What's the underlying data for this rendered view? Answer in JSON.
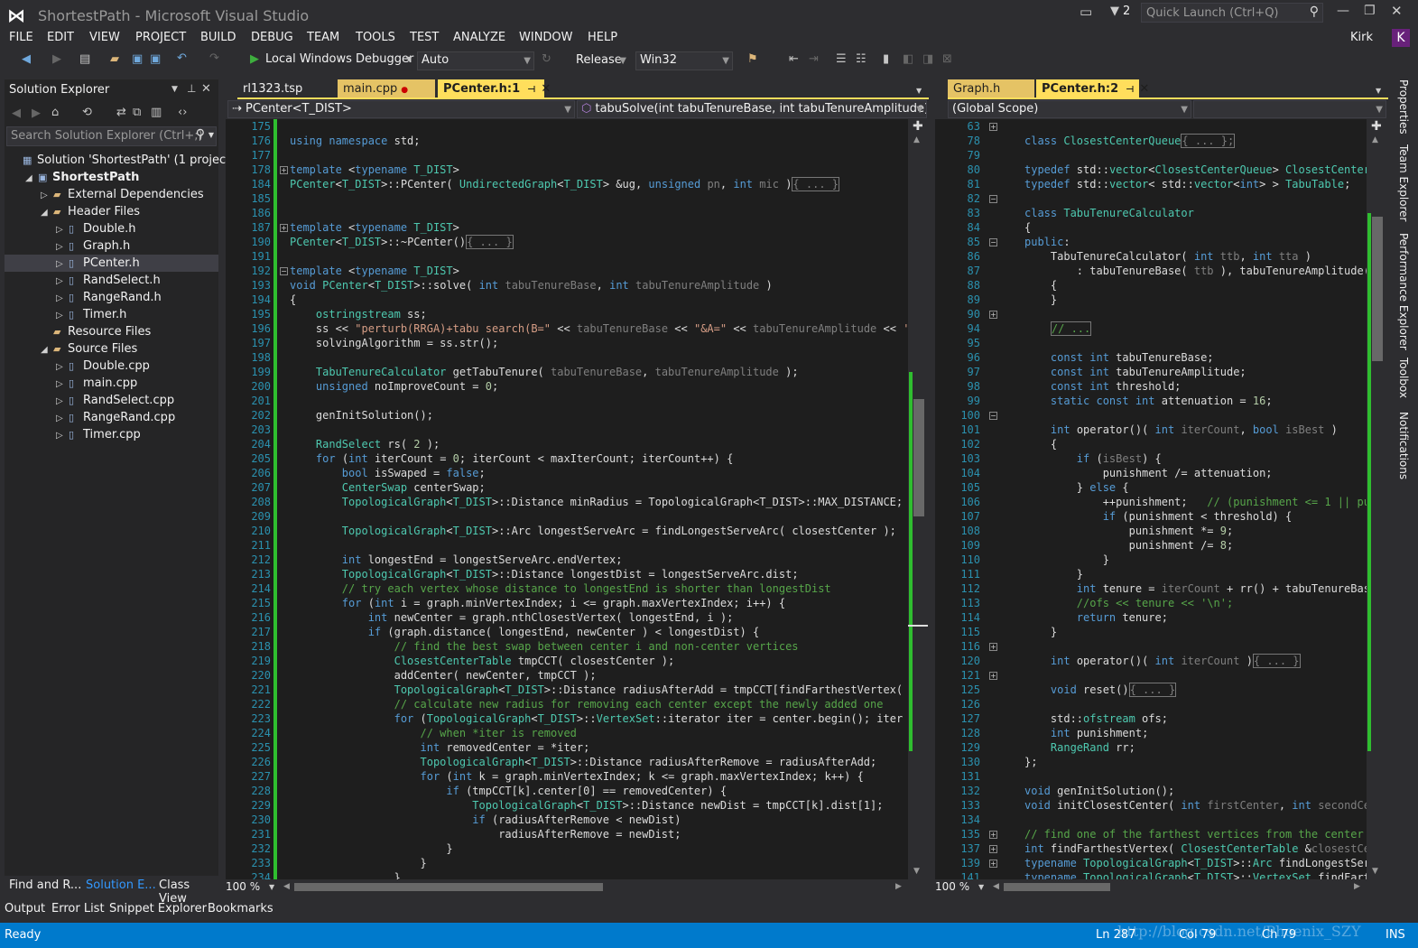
{
  "window": {
    "title": "ShortestPath - Microsoft Visual Studio",
    "notif_count": "2",
    "quick_launch": "Quick Launch (Ctrl+Q)",
    "user": "Kirk",
    "avatar": "K"
  },
  "menu": [
    "FILE",
    "EDIT",
    "VIEW",
    "PROJECT",
    "BUILD",
    "DEBUG",
    "TEAM",
    "TOOLS",
    "TEST",
    "ANALYZE",
    "WINDOW",
    "HELP"
  ],
  "toolbar": {
    "debugger": "Local Windows Debugger",
    "auto": "Auto",
    "config": "Release",
    "platform": "Win32"
  },
  "solution": {
    "title": "Solution Explorer",
    "search": "Search Solution Explorer (Ctrl+;)",
    "items": [
      {
        "label": "Solution 'ShortestPath' (1 project)",
        "indent": 0
      },
      {
        "label": "ShortestPath",
        "indent": 1,
        "bold": true
      },
      {
        "label": "External Dependencies",
        "indent": 2
      },
      {
        "label": "Header Files",
        "indent": 2
      },
      {
        "label": "Double.h",
        "indent": 3
      },
      {
        "label": "Graph.h",
        "indent": 3
      },
      {
        "label": "PCenter.h",
        "indent": 3,
        "selected": true
      },
      {
        "label": "RandSelect.h",
        "indent": 3
      },
      {
        "label": "RangeRand.h",
        "indent": 3
      },
      {
        "label": "Timer.h",
        "indent": 3
      },
      {
        "label": "Resource Files",
        "indent": 2
      },
      {
        "label": "Source Files",
        "indent": 2
      },
      {
        "label": "Double.cpp",
        "indent": 3
      },
      {
        "label": "main.cpp",
        "indent": 3
      },
      {
        "label": "RandSelect.cpp",
        "indent": 3
      },
      {
        "label": "RangeRand.cpp",
        "indent": 3
      },
      {
        "label": "Timer.cpp",
        "indent": 3
      }
    ]
  },
  "bottom_tabs": [
    "Find and R...",
    "Solution E...",
    "Class View"
  ],
  "output_tabs": [
    "Output",
    "Error List",
    "Snippet Explorer",
    "Bookmarks"
  ],
  "status": {
    "ready": "Ready",
    "ln": "Ln 287",
    "col": "Col 79",
    "ch": "Ch 79",
    "ins": "INS",
    "watermark": "http://blog.csdn.net/Phoenix_SZY"
  },
  "left_editor": {
    "tabs": [
      "rl1323.tsp",
      "main.cpp",
      "PCenter.h:1"
    ],
    "nav_left": "PCenter<T_DIST>",
    "nav_right": "tabuSolve(int tabuTenureBase, int tabuTenureAmplitude)",
    "zoom": "100 %"
  },
  "right_editor": {
    "tabs": [
      "Graph.h",
      "PCenter.h:2"
    ],
    "nav_left": "(Global Scope)",
    "zoom": "100 %"
  },
  "side_tabs": [
    "Properties",
    "Team Explorer",
    "Performance Explorer",
    "Toolbox",
    "Notifications"
  ],
  "left_lines": [
    "175",
    "176",
    "177",
    "178",
    "184",
    "185",
    "186",
    "187",
    "190",
    "191",
    "192",
    "193",
    "194",
    "195",
    "196",
    "197",
    "198",
    "199",
    "200",
    "201",
    "202",
    "203",
    "204",
    "205",
    "206",
    "207",
    "208",
    "209",
    "210",
    "211",
    "212",
    "213",
    "214",
    "215",
    "216",
    "217",
    "218",
    "219",
    "220",
    "221",
    "222",
    "223",
    "224",
    "225",
    "226",
    "227",
    "228",
    "229",
    "230",
    "231",
    "232",
    "233",
    "234"
  ],
  "right_lines": [
    "63",
    "78",
    "79",
    "80",
    "81",
    "82",
    "83",
    "84",
    "85",
    "86",
    "87",
    "88",
    "89",
    "90",
    "94",
    "95",
    "96",
    "97",
    "98",
    "99",
    "100",
    "101",
    "102",
    "103",
    "104",
    "105",
    "106",
    "107",
    "108",
    "109",
    "110",
    "111",
    "112",
    "113",
    "114",
    "115",
    "116",
    "120",
    "121",
    "125",
    "126",
    "127",
    "128",
    "129",
    "130",
    "131",
    "132",
    "133",
    "134",
    "135",
    "137",
    "139",
    "141"
  ]
}
